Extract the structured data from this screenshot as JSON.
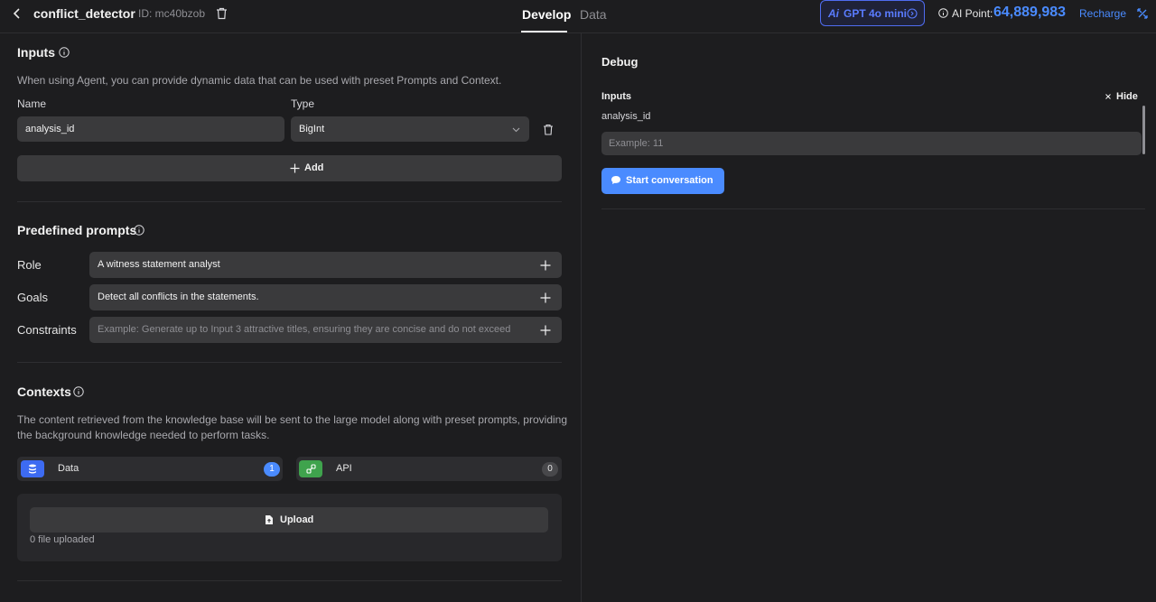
{
  "header": {
    "agent_name": "conflict_detector",
    "agent_id": "ID: mc40bzob",
    "tabs": [
      "Develop",
      "Data"
    ],
    "model": {
      "ai_mark": "Ai",
      "name": "GPT 4o mini"
    },
    "ai_point_label": "AI Point:",
    "ai_point_value": "64,889,983",
    "recharge_label": "Recharge"
  },
  "inputs": {
    "title": "Inputs",
    "description": "When using Agent, you can provide dynamic data that can be used with preset Prompts and Context.",
    "name_col": "Name",
    "type_col": "Type",
    "row": {
      "name": "analysis_id",
      "type": "BigInt"
    },
    "add_label": "Add"
  },
  "prompts": {
    "title": "Predefined prompts",
    "items": [
      {
        "label": "Role",
        "value": "A witness statement analyst",
        "placeholder": ""
      },
      {
        "label": "Goals",
        "value": "Detect all conflicts in the statements.",
        "placeholder": ""
      },
      {
        "label": "Constraints",
        "value": "",
        "placeholder": "Example: Generate up to Input 3 attractive titles, ensuring they are concise and do not exceed"
      }
    ]
  },
  "contexts": {
    "title": "Contexts",
    "description_line1": "The content retrieved from the knowledge base will be sent to the large model along with preset prompts, providing",
    "description_line2": "the background knowledge needed to perform tasks.",
    "cards": [
      {
        "name": "Data",
        "count": "1"
      },
      {
        "name": "API",
        "count": "0"
      }
    ],
    "upload_label": "Upload",
    "upload_status": "0 file uploaded"
  },
  "debug": {
    "title": "Debug",
    "inputs_label": "Inputs",
    "hide_label": "Hide",
    "variable": "analysis_id",
    "field_placeholder": "Example: 11",
    "start_label": "Start conversation"
  },
  "colors": {
    "accent": "#4a8bff",
    "data_icon": "#3d6bf2",
    "api_icon": "#3fa34d"
  }
}
